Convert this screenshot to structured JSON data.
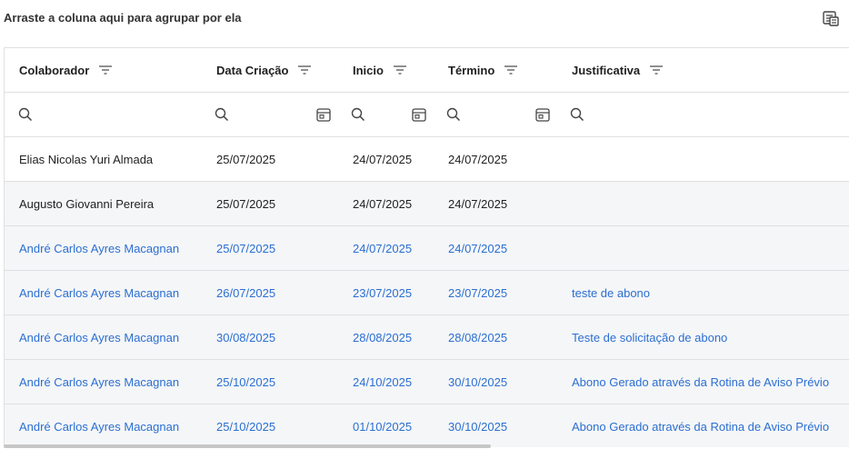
{
  "group_panel": {
    "hint": "Arraste a coluna aqui para agrupar por ela"
  },
  "columns": [
    "Colaborador",
    "Data Criação",
    "Inicio",
    "Término",
    "Justificativa"
  ],
  "rows": [
    {
      "colaborador": "Elias Nicolas Yuri Almada",
      "data_criacao": "25/07/2025",
      "inicio": "24/07/2025",
      "termino": "24/07/2025",
      "justificativa": ""
    },
    {
      "colaborador": "Augusto Giovanni Pereira",
      "data_criacao": "25/07/2025",
      "inicio": "24/07/2025",
      "termino": "24/07/2025",
      "justificativa": ""
    },
    {
      "colaborador": "André Carlos Ayres Macagnan",
      "data_criacao": "25/07/2025",
      "inicio": "24/07/2025",
      "termino": "24/07/2025",
      "justificativa": ""
    },
    {
      "colaborador": "André Carlos Ayres Macagnan",
      "data_criacao": "26/07/2025",
      "inicio": "23/07/2025",
      "termino": "23/07/2025",
      "justificativa": "teste de abono"
    },
    {
      "colaborador": "André Carlos Ayres Macagnan",
      "data_criacao": "30/08/2025",
      "inicio": "28/08/2025",
      "termino": "28/08/2025",
      "justificativa": "Teste de solicitação de abono"
    },
    {
      "colaborador": "André Carlos Ayres Macagnan",
      "data_criacao": "25/10/2025",
      "inicio": "24/10/2025",
      "termino": "30/10/2025",
      "justificativa": "Abono Gerado através da Rotina de Aviso Prévio"
    },
    {
      "colaborador": "André Carlos Ayres Macagnan",
      "data_criacao": "25/10/2025",
      "inicio": "01/10/2025",
      "termino": "30/10/2025",
      "justificativa": "Abono Gerado através da Rotina de Aviso Prévio"
    }
  ],
  "colors": {
    "link_text": "#2b6fd1",
    "row_alt": "#f5f6f8",
    "border": "#e0e0e0"
  }
}
